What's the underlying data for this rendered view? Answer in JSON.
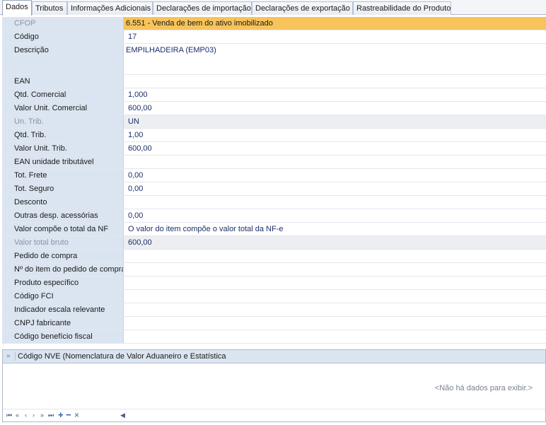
{
  "tabs": [
    {
      "label": "Dados"
    },
    {
      "label": "Tributos"
    },
    {
      "label": "Informações Adicionais"
    },
    {
      "label": "Declarações de importação"
    },
    {
      "label": "Declarações de exportação"
    },
    {
      "label": "Rastreabilidade do Produto"
    }
  ],
  "fields": [
    {
      "label": "CFOP",
      "value": "6.551 - Venda de bem do ativo imobilizado"
    },
    {
      "label": "Código",
      "value": "17"
    },
    {
      "label": "Descrição",
      "value": "EMPILHADEIRA (EMP03)"
    },
    {
      "label": "EAN",
      "value": ""
    },
    {
      "label": "Qtd. Comercial",
      "value": "1,000"
    },
    {
      "label": "Valor Unit. Comercial",
      "value": "600,00"
    },
    {
      "label": "Un. Trib.",
      "value": "UN"
    },
    {
      "label": "Qtd. Trib.",
      "value": "1,00"
    },
    {
      "label": "Valor Unit. Trib.",
      "value": "600,00"
    },
    {
      "label": "EAN unidade tributável",
      "value": ""
    },
    {
      "label": "Tot. Frete",
      "value": "0,00"
    },
    {
      "label": "Tot. Seguro",
      "value": "0,00"
    },
    {
      "label": "Desconto",
      "value": ""
    },
    {
      "label": "Outras desp. acessórias",
      "value": "0,00"
    },
    {
      "label": "Valor compõe o total da NF",
      "value": "O valor do item compõe o valor total da NF-e"
    },
    {
      "label": "Valor total bruto",
      "value": "600,00"
    },
    {
      "label": "Pedido de compra",
      "value": ""
    },
    {
      "label": "Nº do item do pedido de compra",
      "value": ""
    },
    {
      "label": "Produto específico",
      "value": ""
    },
    {
      "label": "Código FCI",
      "value": ""
    },
    {
      "label": "Indicador escala relevante",
      "value": ""
    },
    {
      "label": "CNPJ fabricante",
      "value": ""
    },
    {
      "label": "Código benefício fiscal",
      "value": ""
    }
  ],
  "required_marker": "*",
  "nve": {
    "expand_icon": "»",
    "title": "Código NVE (Nomenclatura de Valor Aduaneiro e Estatística",
    "empty_text": "<Não há dados para exibir.>"
  },
  "nav": {
    "first": "⏮",
    "prev_page": "«",
    "prev": "‹",
    "next": "›",
    "next_page": "»",
    "last": "⏭",
    "add": "+",
    "remove": "−",
    "cancel": "×",
    "scroll_left": "◀"
  },
  "colors": {
    "label_bg": "#dbe5f1",
    "highlight": "#f7c35a",
    "required": "#cc1a1a"
  }
}
